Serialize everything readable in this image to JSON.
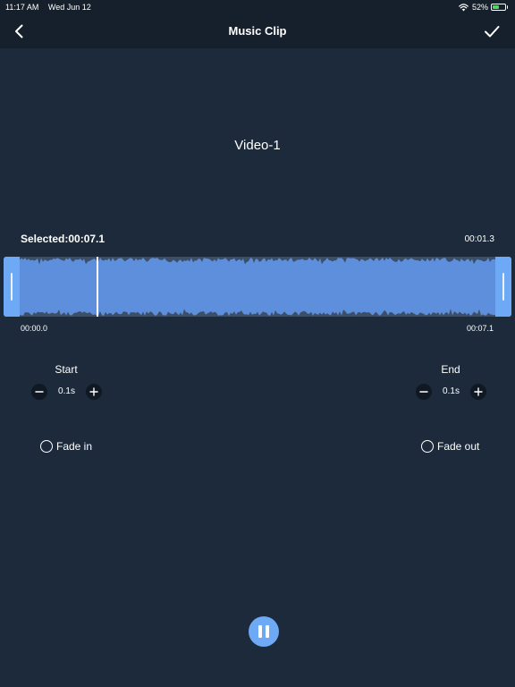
{
  "status_bar": {
    "time": "11:17 AM",
    "date": "Wed Jun 12",
    "battery_percent": "52%",
    "battery_level": 0.52
  },
  "nav": {
    "title": "Music Clip",
    "back_icon": "chevron-left-icon",
    "confirm_icon": "checkmark-icon"
  },
  "video_name": "Video-1",
  "clip": {
    "selected_label": "Selected:00:07.1",
    "current_time": "00:01.3",
    "range_start": "00:00.0",
    "range_end": "00:07.1",
    "playhead_fraction": 0.183
  },
  "start_control": {
    "label": "Start",
    "value": "0.1s"
  },
  "end_control": {
    "label": "End",
    "value": "0.1s"
  },
  "fade_in": {
    "label": "Fade in",
    "checked": false
  },
  "fade_out": {
    "label": "Fade out",
    "checked": false
  },
  "colors": {
    "background": "#1c2a3b",
    "bar_background": "#16202c",
    "accent": "#6ea9f5",
    "waveform": "#5d8fdc"
  }
}
